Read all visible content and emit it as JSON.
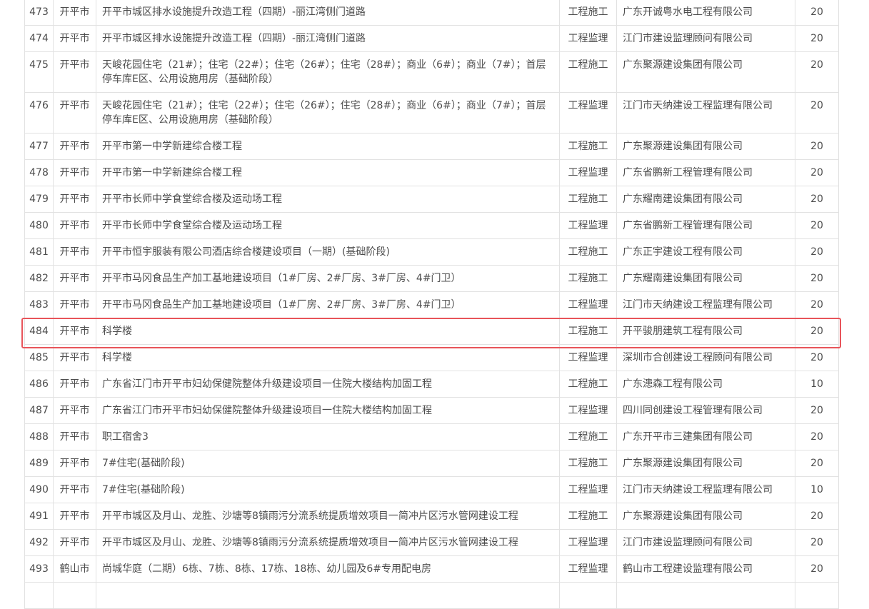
{
  "table": {
    "rows": [
      {
        "idx": "473",
        "city": "开平市",
        "project": "开平市城区排水设施提升改造工程（四期）-丽江湾侧门道路",
        "type": "工程施工",
        "company": "广东开诚粤水电工程有限公司",
        "score": "20",
        "lines": 1
      },
      {
        "idx": "474",
        "city": "开平市",
        "project": "开平市城区排水设施提升改造工程（四期）-丽江湾侧门道路",
        "type": "工程监理",
        "company": "江门市建设监理顾问有限公司",
        "score": "20",
        "lines": 1
      },
      {
        "idx": "475",
        "city": "开平市",
        "project": "天峻花园住宅（21#）；住宅（22#）；住宅（26#）；住宅（28#）；商业（6#）；商业（7#）；首层停车库E区、公用设施用房（基础阶段）",
        "type": "工程施工",
        "company": "广东聚源建设集团有限公司",
        "score": "20",
        "lines": 2
      },
      {
        "idx": "476",
        "city": "开平市",
        "project": "天峻花园住宅（21#）；住宅（22#）；住宅（26#）；住宅（28#）；商业（6#）；商业（7#）；首层停车库E区、公用设施用房（基础阶段）",
        "type": "工程监理",
        "company": "江门市天纳建设工程监理有限公司",
        "score": "20",
        "lines": 2
      },
      {
        "idx": "477",
        "city": "开平市",
        "project": "开平市第一中学新建综合楼工程",
        "type": "工程施工",
        "company": "广东聚源建设集团有限公司",
        "score": "20",
        "lines": 1
      },
      {
        "idx": "478",
        "city": "开平市",
        "project": "开平市第一中学新建综合楼工程",
        "type": "工程监理",
        "company": "广东省鹏新工程管理有限公司",
        "score": "20",
        "lines": 1
      },
      {
        "idx": "479",
        "city": "开平市",
        "project": "开平市长师中学食堂综合楼及运动场工程",
        "type": "工程施工",
        "company": "广东耀南建设集团有限公司",
        "score": "20",
        "lines": 1
      },
      {
        "idx": "480",
        "city": "开平市",
        "project": "开平市长师中学食堂综合楼及运动场工程",
        "type": "工程监理",
        "company": "广东省鹏新工程管理有限公司",
        "score": "20",
        "lines": 1
      },
      {
        "idx": "481",
        "city": "开平市",
        "project": "开平市恒宇服装有限公司酒店综合楼建设项目（一期）(基础阶段)",
        "type": "工程施工",
        "company": "广东正宇建设工程有限公司",
        "score": "20",
        "lines": 1
      },
      {
        "idx": "482",
        "city": "开平市",
        "project": "开平市马冈食品生产加工基地建设项目（1#厂房、2#厂房、3#厂房、4#门卫）",
        "type": "工程施工",
        "company": "广东耀南建设集团有限公司",
        "score": "20",
        "lines": 1
      },
      {
        "idx": "483",
        "city": "开平市",
        "project": "开平市马冈食品生产加工基地建设项目（1#厂房、2#厂房、3#厂房、4#门卫）",
        "type": "工程监理",
        "company": "江门市天纳建设工程监理有限公司",
        "score": "20",
        "lines": 1
      },
      {
        "idx": "484",
        "city": "开平市",
        "project": "科学楼",
        "type": "工程施工",
        "company": "开平骏朋建筑工程有限公司",
        "score": "20",
        "lines": 1
      },
      {
        "idx": "485",
        "city": "开平市",
        "project": "科学楼",
        "type": "工程监理",
        "company": "深圳市合创建设工程顾问有限公司",
        "score": "20",
        "lines": 1
      },
      {
        "idx": "486",
        "city": "开平市",
        "project": "广东省江门市开平市妇幼保健院整体升级建设项目一住院大楼结构加固工程",
        "type": "工程施工",
        "company": "广东漶森工程有限公司",
        "score": "10",
        "lines": 1
      },
      {
        "idx": "487",
        "city": "开平市",
        "project": "广东省江门市开平市妇幼保健院整体升级建设项目一住院大楼结构加固工程",
        "type": "工程监理",
        "company": "四川同创建设工程管理有限公司",
        "score": "20",
        "lines": 1
      },
      {
        "idx": "488",
        "city": "开平市",
        "project": "职工宿舍3",
        "type": "工程施工",
        "company": "广东开平市三建集团有限公司",
        "score": "20",
        "lines": 1
      },
      {
        "idx": "489",
        "city": "开平市",
        "project": "7#住宅(基础阶段)",
        "type": "工程施工",
        "company": "广东聚源建设集团有限公司",
        "score": "20",
        "lines": 1
      },
      {
        "idx": "490",
        "city": "开平市",
        "project": "7#住宅(基础阶段)",
        "type": "工程监理",
        "company": "江门市天纳建设工程监理有限公司",
        "score": "10",
        "lines": 1
      },
      {
        "idx": "491",
        "city": "开平市",
        "project": "开平市城区及月山、龙胜、沙塘等8镇雨污分流系统提质增效项目一简冲片区污水管网建设工程",
        "type": "工程施工",
        "company": "广东聚源建设集团有限公司",
        "score": "20",
        "lines": 1
      },
      {
        "idx": "492",
        "city": "开平市",
        "project": "开平市城区及月山、龙胜、沙塘等8镇雨污分流系统提质增效项目一简冲片区污水管网建设工程",
        "type": "工程监理",
        "company": "江门市建设监理顾问有限公司",
        "score": "20",
        "lines": 1
      },
      {
        "idx": "493",
        "city": "鹤山市",
        "project": "尚城华庭（二期）6栋、7栋、8栋、17栋、18栋、幼儿园及6#专用配电房",
        "type": "工程监理",
        "company": "鹤山市工程建设监理有限公司",
        "score": "20",
        "lines": 1
      },
      {
        "idx": "",
        "city": "",
        "project": "",
        "type": "",
        "company": "",
        "score": "",
        "lines": 1
      }
    ]
  }
}
